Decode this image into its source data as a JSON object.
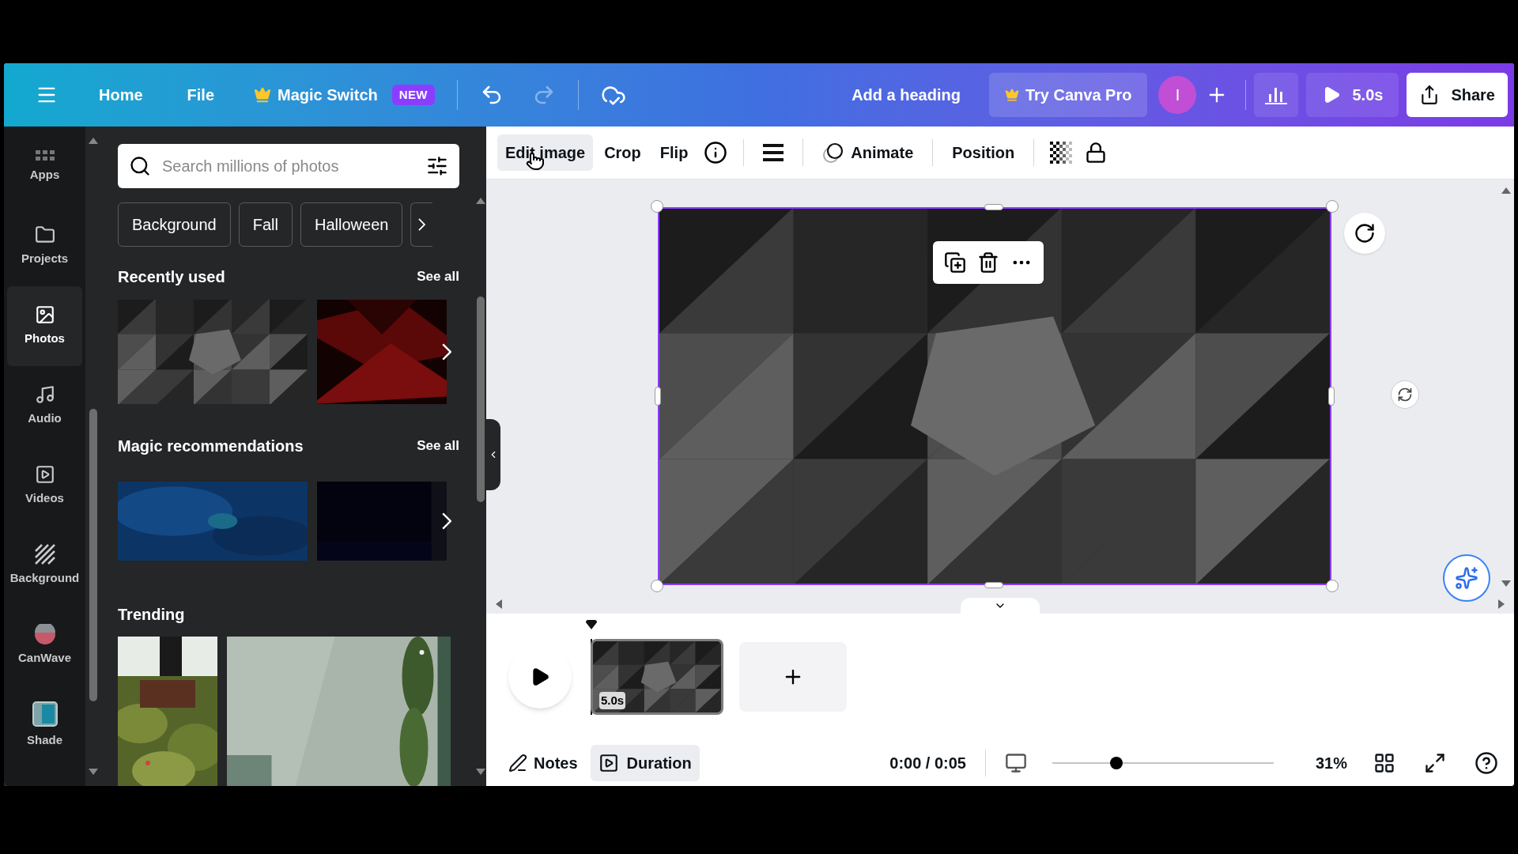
{
  "topbar": {
    "menu_items": [
      "Home",
      "File"
    ],
    "magic_switch": {
      "label": "Magic Switch",
      "badge": "NEW"
    },
    "redo_disabled": true,
    "title": "Add a heading",
    "pro_button": "Try Canva Pro",
    "avatar": "I",
    "play_button": "5.0s",
    "share_button": "Share"
  },
  "sidebar": {
    "items": [
      {
        "label": "Apps",
        "kind": "apps",
        "selected": false
      },
      {
        "label": "Projects",
        "kind": "folder",
        "selected": false
      },
      {
        "label": "Photos",
        "selected": true
      },
      {
        "label": "Audio",
        "kind": "music",
        "selected": false
      },
      {
        "label": "Videos",
        "kind": "video",
        "selected": false
      },
      {
        "label": "Background",
        "kind": "hatch",
        "selected": false
      },
      {
        "label": "CanWave",
        "kind": "dot",
        "selected": false
      },
      {
        "label": "Shade",
        "kind": "swatch",
        "selected": false
      }
    ]
  },
  "panel": {
    "search": {
      "placeholder": "Search millions of photos"
    },
    "chips": [
      "Background",
      "Fall",
      "Halloween"
    ],
    "sections": [
      {
        "title": "Recently used",
        "see_all": "See all"
      },
      {
        "title": "Magic recommendations",
        "see_all": "See all"
      },
      {
        "title": "Trending"
      }
    ]
  },
  "toolbar": {
    "items": [
      {
        "label": "Edit image",
        "kind": "text",
        "selected": true
      },
      {
        "label": "Crop",
        "kind": "text",
        "selected": false
      },
      {
        "label": "Flip",
        "kind": "text",
        "selected": false
      },
      {
        "kind": "info"
      },
      {
        "kind": "divider"
      },
      {
        "kind": "lines"
      },
      {
        "kind": "divider"
      },
      {
        "label": "Animate",
        "kind": "animate",
        "selected": false
      },
      {
        "kind": "divider"
      },
      {
        "label": "Position",
        "kind": "text",
        "selected": false
      },
      {
        "kind": "divider"
      },
      {
        "kind": "transparency"
      },
      {
        "kind": "lock"
      }
    ]
  },
  "timeline": {
    "pages": [
      {
        "duration": "5.0s",
        "selected": true
      }
    ]
  },
  "bottom_bar": {
    "notes": {
      "label": "Notes",
      "selected": false
    },
    "duration": {
      "label": "Duration",
      "selected": true
    },
    "time": "0:00 / 0:05",
    "zoom": {
      "level": 0.29,
      "reading": "31%"
    }
  }
}
